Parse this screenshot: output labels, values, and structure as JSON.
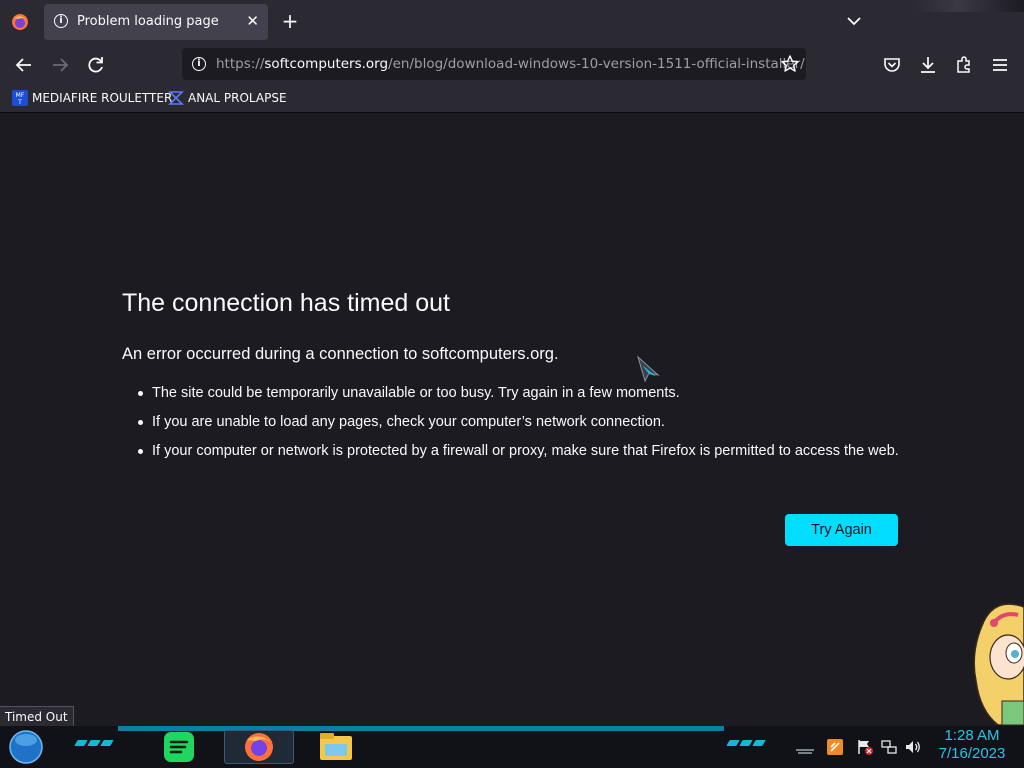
{
  "browser": {
    "tab": {
      "title": "Problem loading page",
      "close": "✕"
    },
    "new_tab": "+",
    "url": {
      "scheme": "https://",
      "host": "softcomputers.org",
      "path": "/en/blog/download-windows-10-version-1511-official-installer/"
    },
    "bookmarks": [
      {
        "label": "MEDIAFIRE ROULETTER",
        "icon": "mediafire-icon"
      },
      {
        "label": "ANAL PROLAPSE",
        "icon": "sigma-icon"
      }
    ],
    "status_text": "Timed Out"
  },
  "error": {
    "title": "The connection has timed out",
    "subtitle": "An error occurred during a connection to softcomputers.org.",
    "items": [
      "The site could be temporarily unavailable or too busy. Try again in a few moments.",
      "If you are unable to load any pages, check your computer’s network connection.",
      "If your computer or network is protected by a firewall or proxy, make sure that Firefox is permitted to access the web."
    ],
    "button": "Try Again"
  },
  "taskbar": {
    "apps": [
      "spotify-icon",
      "firefox-icon",
      "file-explorer-icon"
    ],
    "tray_icons": [
      "keyboard-icon",
      "app-tray-icon",
      "flag-icon",
      "network-icon",
      "volume-icon"
    ],
    "time": "1:28 AM",
    "date": "7/16/2023"
  },
  "colors": {
    "page_bg": "#1c1b22",
    "chrome_bg": "#2b2a33",
    "accent_button": "#00ddff",
    "clock": "#27c4e3"
  }
}
